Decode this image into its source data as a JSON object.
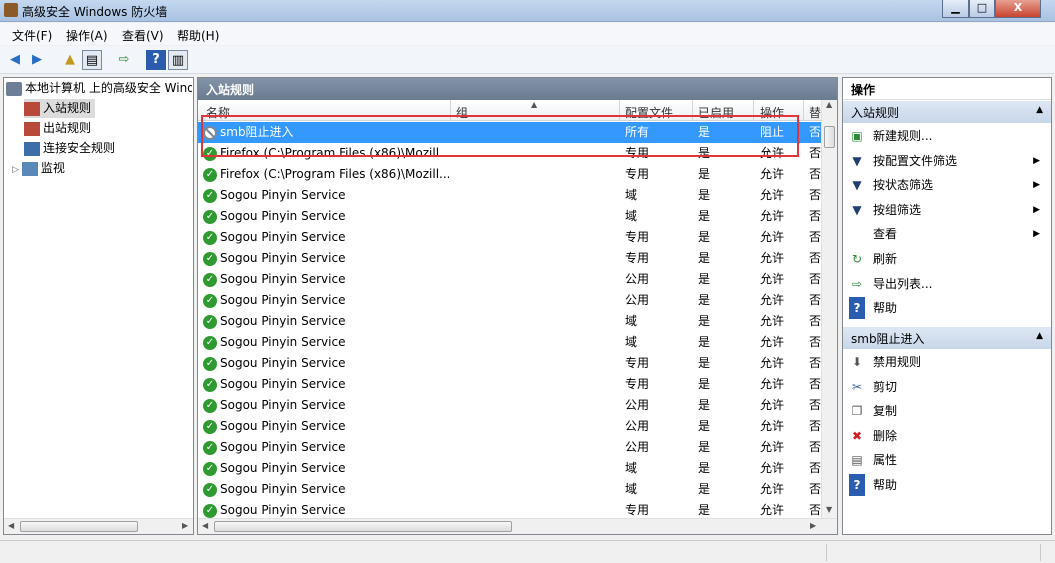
{
  "window": {
    "title": "高级安全 Windows 防火墙",
    "min": "▁",
    "max": "□",
    "close": "X"
  },
  "menu": [
    "文件(F)",
    "操作(A)",
    "查看(V)",
    "帮助(H)"
  ],
  "tree": {
    "root": "本地计算机 上的高级安全 Windows",
    "items": [
      "入站规则",
      "出站规则",
      "连接安全规则",
      "监视"
    ]
  },
  "center": {
    "title": "入站规则",
    "columns": [
      "名称",
      "组",
      "配置文件",
      "已启用",
      "操作",
      "替"
    ],
    "rows": [
      {
        "name": "smb阻止进入",
        "profile": "所有",
        "enabled": "是",
        "action": "阻止",
        "override": "否",
        "icon": "block"
      },
      {
        "name": "Firefox (C:\\Program Files (x86)\\Mozill...",
        "profile": "专用",
        "enabled": "是",
        "action": "允许",
        "override": "否",
        "icon": "allow"
      },
      {
        "name": "Firefox (C:\\Program Files (x86)\\Mozill...",
        "profile": "专用",
        "enabled": "是",
        "action": "允许",
        "override": "否",
        "icon": "allow"
      },
      {
        "name": "Sogou Pinyin Service",
        "profile": "域",
        "enabled": "是",
        "action": "允许",
        "override": "否",
        "icon": "allow"
      },
      {
        "name": "Sogou Pinyin Service",
        "profile": "域",
        "enabled": "是",
        "action": "允许",
        "override": "否",
        "icon": "allow"
      },
      {
        "name": "Sogou Pinyin Service",
        "profile": "专用",
        "enabled": "是",
        "action": "允许",
        "override": "否",
        "icon": "allow"
      },
      {
        "name": "Sogou Pinyin Service",
        "profile": "专用",
        "enabled": "是",
        "action": "允许",
        "override": "否",
        "icon": "allow"
      },
      {
        "name": "Sogou Pinyin Service",
        "profile": "公用",
        "enabled": "是",
        "action": "允许",
        "override": "否",
        "icon": "allow"
      },
      {
        "name": "Sogou Pinyin Service",
        "profile": "公用",
        "enabled": "是",
        "action": "允许",
        "override": "否",
        "icon": "allow"
      },
      {
        "name": "Sogou Pinyin Service",
        "profile": "域",
        "enabled": "是",
        "action": "允许",
        "override": "否",
        "icon": "allow"
      },
      {
        "name": "Sogou Pinyin Service",
        "profile": "域",
        "enabled": "是",
        "action": "允许",
        "override": "否",
        "icon": "allow"
      },
      {
        "name": "Sogou Pinyin Service",
        "profile": "专用",
        "enabled": "是",
        "action": "允许",
        "override": "否",
        "icon": "allow"
      },
      {
        "name": "Sogou Pinyin Service",
        "profile": "专用",
        "enabled": "是",
        "action": "允许",
        "override": "否",
        "icon": "allow"
      },
      {
        "name": "Sogou Pinyin Service",
        "profile": "公用",
        "enabled": "是",
        "action": "允许",
        "override": "否",
        "icon": "allow"
      },
      {
        "name": "Sogou Pinyin Service",
        "profile": "公用",
        "enabled": "是",
        "action": "允许",
        "override": "否",
        "icon": "allow"
      },
      {
        "name": "Sogou Pinyin Service",
        "profile": "公用",
        "enabled": "是",
        "action": "允许",
        "override": "否",
        "icon": "allow"
      },
      {
        "name": "Sogou Pinyin Service",
        "profile": "域",
        "enabled": "是",
        "action": "允许",
        "override": "否",
        "icon": "allow"
      },
      {
        "name": "Sogou Pinyin Service",
        "profile": "域",
        "enabled": "是",
        "action": "允许",
        "override": "否",
        "icon": "allow"
      },
      {
        "name": "Sogou Pinyin Service",
        "profile": "专用",
        "enabled": "是",
        "action": "允许",
        "override": "否",
        "icon": "allow"
      }
    ]
  },
  "actions": {
    "title": "操作",
    "section1": "入站规则",
    "items1": [
      {
        "label": "新建规则...",
        "icon": "new-rule-icon",
        "arrow": false
      },
      {
        "label": "按配置文件筛选",
        "icon": "filter-icon",
        "arrow": true
      },
      {
        "label": "按状态筛选",
        "icon": "filter-icon",
        "arrow": true
      },
      {
        "label": "按组筛选",
        "icon": "filter-icon",
        "arrow": true
      },
      {
        "label": "查看",
        "icon": "",
        "arrow": true
      },
      {
        "label": "刷新",
        "icon": "refresh-icon",
        "arrow": false
      },
      {
        "label": "导出列表...",
        "icon": "export-icon",
        "arrow": false
      },
      {
        "label": "帮助",
        "icon": "help-icon",
        "arrow": false
      }
    ],
    "section2": "smb阻止进入",
    "items2": [
      {
        "label": "禁用规则",
        "icon": "disable-icon"
      },
      {
        "label": "剪切",
        "icon": "cut-icon"
      },
      {
        "label": "复制",
        "icon": "copy-icon"
      },
      {
        "label": "删除",
        "icon": "delete-icon"
      },
      {
        "label": "属性",
        "icon": "properties-icon"
      },
      {
        "label": "帮助",
        "icon": "help-icon"
      }
    ]
  }
}
